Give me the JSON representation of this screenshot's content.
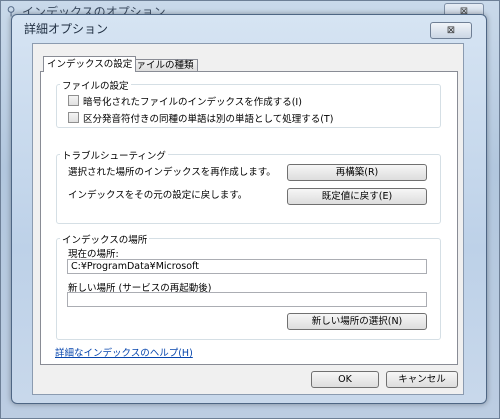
{
  "background_window": {
    "title": "インデックスのオプション",
    "close_glyph": "⊠"
  },
  "dialog": {
    "title": "詳細オプション",
    "close_glyph": "⊠"
  },
  "tabs": [
    {
      "label": "インデックスの設定",
      "active": true
    },
    {
      "label": "ファイルの種類",
      "active": false
    }
  ],
  "file_settings": {
    "legend": "ファイルの設定",
    "options": [
      {
        "label": "暗号化されたファイルのインデックスを作成する(I)",
        "checked": false
      },
      {
        "label": "区分発音符付きの同種の単語は別の単語として処理する(T)",
        "checked": false
      }
    ]
  },
  "troubleshooting": {
    "legend": "トラブルシューティング",
    "rebuild_text": "選択された場所のインデックスを再作成します。",
    "rebuild_button": "再構築(R)",
    "reset_text": "インデックスをその元の設定に戻します。",
    "reset_button": "既定値に戻す(E)"
  },
  "index_location": {
    "legend": "インデックスの場所",
    "current_label": "現在の場所:",
    "current_value": "C:¥ProgramData¥Microsoft",
    "new_label": "新しい場所 (サービスの再起動後)",
    "new_value": "",
    "select_button": "新しい場所の選択(N)"
  },
  "help_link": "詳細なインデックスのヘルプ(H)",
  "footer": {
    "ok": "OK",
    "cancel": "キャンセル"
  }
}
